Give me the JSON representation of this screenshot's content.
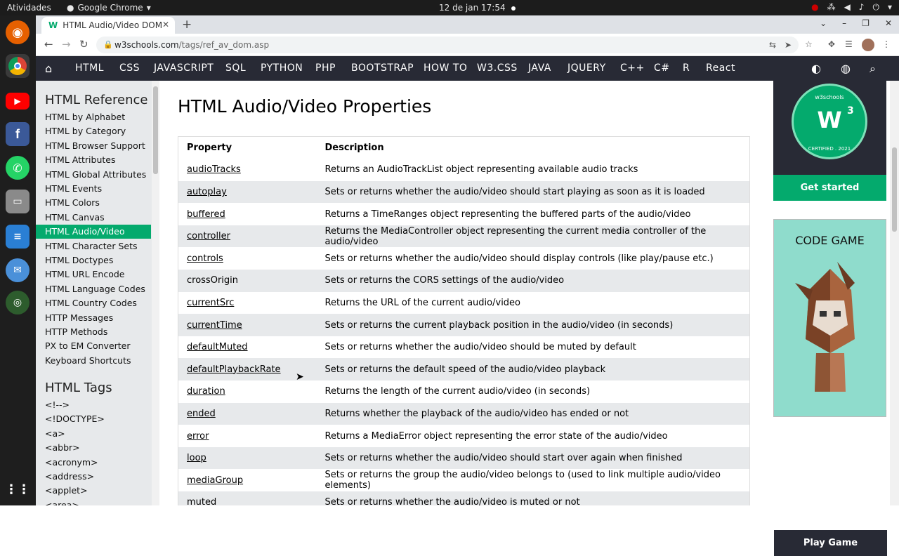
{
  "system": {
    "activities": "Atividades",
    "app_name": "Google Chrome",
    "clock": "12 de jan  17:54"
  },
  "browser": {
    "tab_title": "HTML Audio/Video DOM",
    "url_host": "w3schools.com",
    "url_path": "/tags/ref_av_dom.asp"
  },
  "nav": {
    "items": [
      "HTML",
      "CSS",
      "JAVASCRIPT",
      "SQL",
      "PYTHON",
      "PHP",
      "BOOTSTRAP",
      "HOW TO",
      "W3.CSS",
      "JAVA",
      "JQUERY",
      "C++",
      "C#",
      "R",
      "React"
    ]
  },
  "sidebar": {
    "heading1": "HTML Reference",
    "items": [
      "HTML by Alphabet",
      "HTML by Category",
      "HTML Browser Support",
      "HTML Attributes",
      "HTML Global Attributes",
      "HTML Events",
      "HTML Colors",
      "HTML Canvas",
      "HTML Audio/Video",
      "HTML Character Sets",
      "HTML Doctypes",
      "HTML URL Encode",
      "HTML Language Codes",
      "HTML Country Codes",
      "HTTP Messages",
      "HTTP Methods",
      "PX to EM Converter",
      "Keyboard Shortcuts"
    ],
    "active_index": 8,
    "heading2": "HTML Tags",
    "tags": [
      "<!-->",
      "<!DOCTYPE>",
      "<a>",
      "<abbr>",
      "<acronym>",
      "<address>",
      "<applet>",
      "<area>"
    ]
  },
  "main": {
    "title": "HTML Audio/Video Properties",
    "table": {
      "headers": [
        "Property",
        "Description"
      ],
      "rows": [
        {
          "prop": "audioTracks",
          "desc": "Returns an AudioTrackList object representing available audio tracks",
          "link": true
        },
        {
          "prop": "autoplay",
          "desc": "Sets or returns whether the audio/video should start playing as soon as it is loaded",
          "link": true
        },
        {
          "prop": "buffered",
          "desc": "Returns a TimeRanges object representing the buffered parts of the audio/video",
          "link": true
        },
        {
          "prop": "controller",
          "desc": "Returns the MediaController object representing the current media controller of the audio/video",
          "link": true
        },
        {
          "prop": "controls",
          "desc": "Sets or returns whether the audio/video should display controls (like play/pause etc.)",
          "link": true
        },
        {
          "prop": "crossOrigin",
          "desc": "Sets or returns the CORS settings of the audio/video",
          "link": false
        },
        {
          "prop": "currentSrc",
          "desc": "Returns the URL of the current audio/video",
          "link": true
        },
        {
          "prop": "currentTime",
          "desc": "Sets or returns the current playback position in the audio/video (in seconds)",
          "link": true
        },
        {
          "prop": "defaultMuted",
          "desc": "Sets or returns whether the audio/video should be muted by default",
          "link": true
        },
        {
          "prop": "defaultPlaybackRate",
          "desc": "Sets or returns the default speed of the audio/video playback",
          "link": true
        },
        {
          "prop": "duration",
          "desc": "Returns the length of the current audio/video (in seconds)",
          "link": true
        },
        {
          "prop": "ended",
          "desc": "Returns whether the playback of the audio/video has ended or not",
          "link": true
        },
        {
          "prop": "error",
          "desc": "Returns a MediaError object representing the error state of the audio/video",
          "link": true
        },
        {
          "prop": "loop",
          "desc": "Sets or returns whether the audio/video should start over again when finished",
          "link": true
        },
        {
          "prop": "mediaGroup",
          "desc": "Sets or returns the group the audio/video belongs to (used to link multiple audio/video elements)",
          "link": true
        },
        {
          "prop": "muted",
          "desc": "Sets or returns whether the audio/video is muted or not",
          "link": true
        }
      ]
    }
  },
  "aside": {
    "badge_top": "w3schools",
    "badge_main": "W",
    "badge_sup": "3",
    "badge_bottom": "CERTIFIED . 2021",
    "get_started": "Get started",
    "game_title": "CODE GAME",
    "play_game": "Play Game"
  },
  "colors": {
    "accent": "#04aa6d",
    "nav_bg": "#282a35",
    "sidebar_bg": "#e7e9eb"
  }
}
